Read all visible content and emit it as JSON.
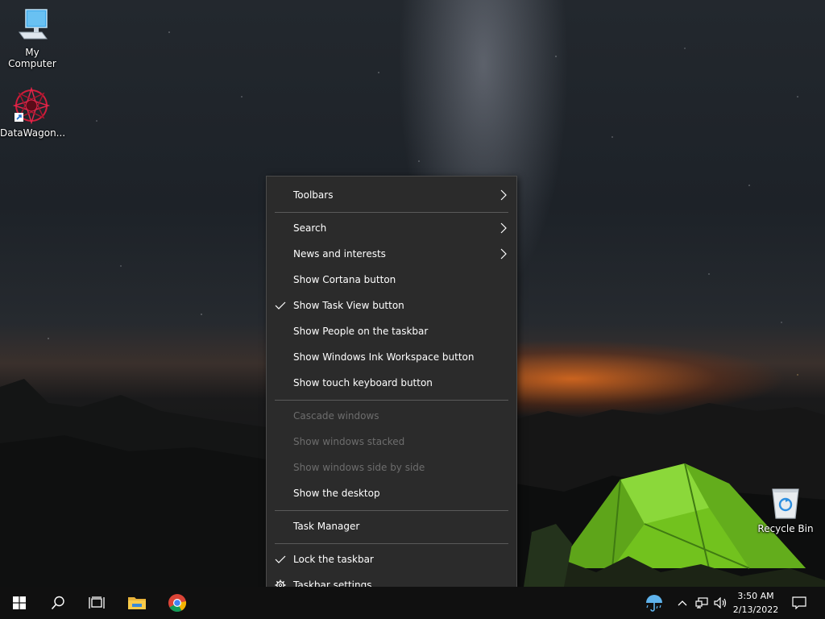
{
  "desktop": {
    "icons": [
      {
        "label": "My Computer"
      },
      {
        "label": "DataWagon..."
      },
      {
        "label": "Recycle Bin"
      }
    ]
  },
  "context_menu": {
    "toolbars": "Toolbars",
    "search": "Search",
    "news": "News and interests",
    "cortana": "Show Cortana button",
    "task_view": "Show Task View button",
    "people": "Show People on the taskbar",
    "ink": "Show Windows Ink Workspace button",
    "touch_keyboard": "Show touch keyboard button",
    "cascade": "Cascade windows",
    "stacked": "Show windows stacked",
    "side_by_side": "Show windows side by side",
    "show_desktop": "Show the desktop",
    "task_manager": "Task Manager",
    "lock": "Lock the taskbar",
    "settings": "Taskbar settings",
    "checked": {
      "task_view": true,
      "lock": true
    }
  },
  "taskbar": {
    "clock_time": "3:50 AM",
    "clock_date": "2/13/2022",
    "buttons": [
      "start-icon",
      "search-icon",
      "task-view-icon",
      "file-explorer-icon",
      "chrome-icon"
    ],
    "tray": [
      "weather-umbrella-icon",
      "chevron-up-icon",
      "network-icon",
      "volume-icon",
      "notification-icon"
    ]
  },
  "colors": {
    "menu_bg": "#2b2b2b",
    "menu_text": "#ffffff",
    "menu_disabled": "#6d6d6d",
    "taskbar_bg": "#101010",
    "tent_green": "#7ed321"
  }
}
